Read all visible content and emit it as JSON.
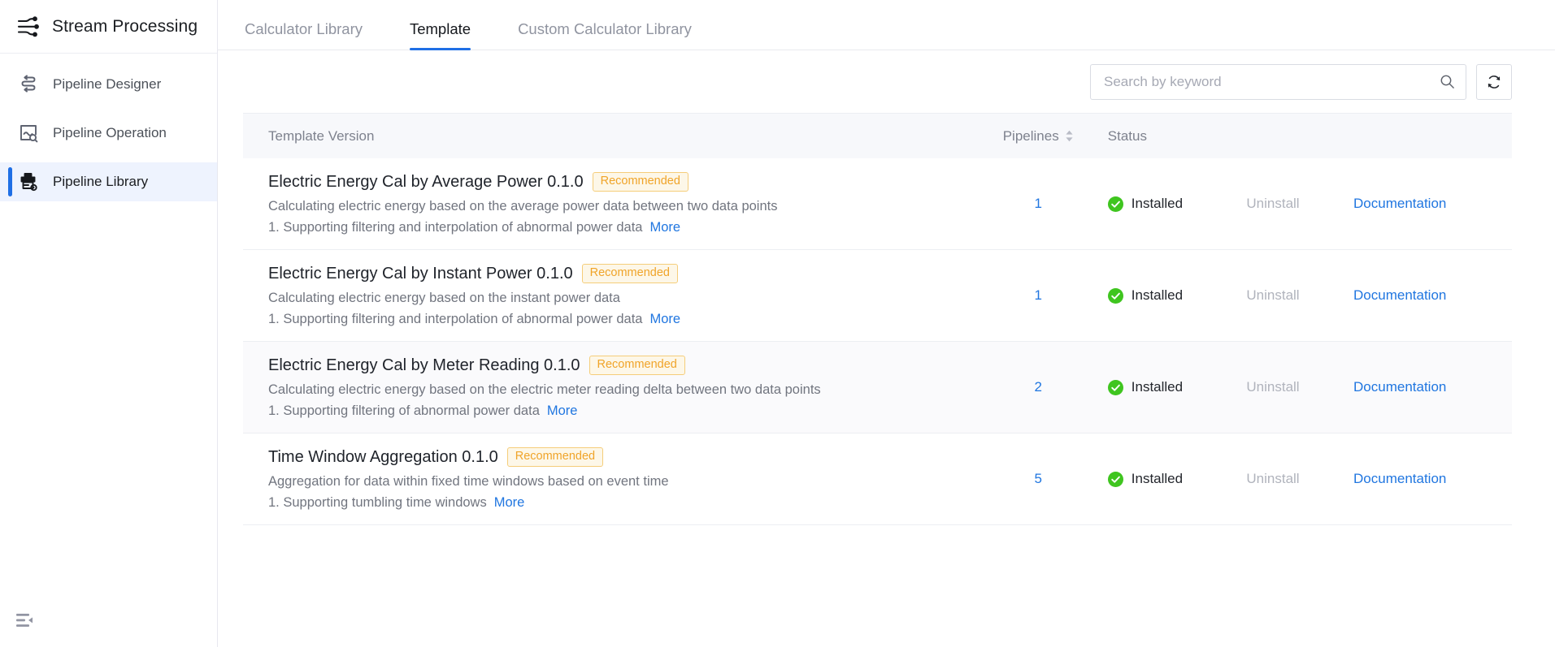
{
  "sidebar": {
    "brand": {
      "title": "Stream Processing",
      "icon": "stream-processing-logo-icon"
    },
    "items": [
      {
        "label": "Pipeline Designer",
        "icon": "pipeline-designer-icon",
        "active": false
      },
      {
        "label": "Pipeline Operation",
        "icon": "pipeline-operation-icon",
        "active": false
      },
      {
        "label": "Pipeline Library",
        "icon": "pipeline-library-icon",
        "active": true
      }
    ],
    "collapse_icon": "sidebar-collapse-icon",
    "accent_color": "#1f6fe5",
    "active_bg_color": "#eef3fe"
  },
  "tabs": [
    {
      "label": "Calculator Library",
      "active": false
    },
    {
      "label": "Template",
      "active": true
    },
    {
      "label": "Custom Calculator Library",
      "active": false
    }
  ],
  "toolbar": {
    "search_placeholder": "Search by keyword",
    "search_value": "",
    "search_icon": "search-icon",
    "refresh_icon": "refresh-icon"
  },
  "table": {
    "columns": {
      "name": "Template Version",
      "pipelines": "Pipelines",
      "status": "Status",
      "action_uninstall": "",
      "action_documentation": ""
    },
    "sortable": {
      "pipelines": true
    },
    "rows": [
      {
        "title": "Electric Energy Cal by Average Power 0.1.0",
        "badge": "Recommended",
        "description": "Calculating electric energy based on the average power data between two data points",
        "feature": "1. Supporting filtering and interpolation of abnormal power data",
        "more": "More",
        "pipelines": "1",
        "status": "Installed",
        "status_color": "#3fc51f",
        "uninstall": "Uninstall",
        "documentation": "Documentation",
        "highlight": false
      },
      {
        "title": "Electric Energy Cal by Instant Power 0.1.0",
        "badge": "Recommended",
        "description": "Calculating electric energy based on the instant power data",
        "feature": "1. Supporting filtering and interpolation of abnormal power data",
        "more": "More",
        "pipelines": "1",
        "status": "Installed",
        "status_color": "#3fc51f",
        "uninstall": "Uninstall",
        "documentation": "Documentation",
        "highlight": false
      },
      {
        "title": "Electric Energy Cal by Meter Reading 0.1.0",
        "badge": "Recommended",
        "description": "Calculating electric energy based on the electric meter reading delta between two data points",
        "feature": "1. Supporting filtering of abnormal power data",
        "more": "More",
        "pipelines": "2",
        "status": "Installed",
        "status_color": "#3fc51f",
        "uninstall": "Uninstall",
        "documentation": "Documentation",
        "highlight": true
      },
      {
        "title": "Time Window Aggregation 0.1.0",
        "badge": "Recommended",
        "description": "Aggregation for data within fixed time windows based on event time",
        "feature": "1. Supporting tumbling time windows",
        "more": "More",
        "pipelines": "5",
        "status": "Installed",
        "status_color": "#3fc51f",
        "uninstall": "Uninstall",
        "documentation": "Documentation",
        "highlight": false
      }
    ]
  }
}
